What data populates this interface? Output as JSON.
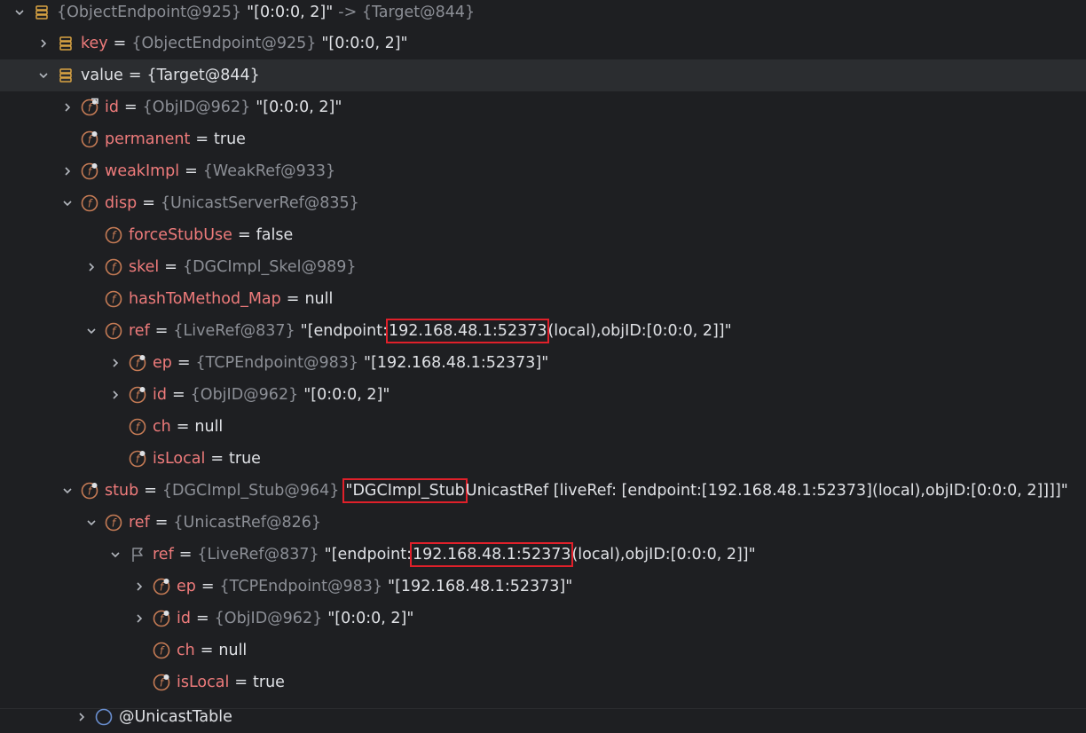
{
  "rows": [
    {
      "name": "",
      "type": "{ObjectEndpoint@925}",
      "value": "\"[0:0:0, 2]\"",
      "extra": "-> {Target@844}"
    },
    {
      "name": "key",
      "type": "{ObjectEndpoint@925}",
      "value": "\"[0:0:0, 2]\""
    },
    {
      "name": "value",
      "type": "{Target@844}",
      "value": ""
    },
    {
      "name": "id",
      "type": "{ObjID@962}",
      "value": "\"[0:0:0, 2]\""
    },
    {
      "name": "permanent",
      "type": "",
      "value": "true"
    },
    {
      "name": "weakImpl",
      "type": "{WeakRef@933}",
      "value": ""
    },
    {
      "name": "disp",
      "type": "{UnicastServerRef@835}",
      "value": ""
    },
    {
      "name": "forceStubUse",
      "type": "",
      "value": "false"
    },
    {
      "name": "skel",
      "type": "{DGCImpl_Skel@989}",
      "value": ""
    },
    {
      "name": "hashToMethod_Map",
      "type": "",
      "value": "null"
    },
    {
      "name": "ref",
      "type": "{LiveRef@837}",
      "pre": "\"[endpoint:",
      "hl": "192.168.48.1:52373",
      "post": "(local),objID:[0:0:0, 2]]\""
    },
    {
      "name": "ep",
      "type": "{TCPEndpoint@983}",
      "value": "\"[192.168.48.1:52373]\""
    },
    {
      "name": "id",
      "type": "{ObjID@962}",
      "value": "\"[0:0:0, 2]\""
    },
    {
      "name": "ch",
      "type": "",
      "value": "null"
    },
    {
      "name": "isLocal",
      "type": "",
      "value": "true"
    },
    {
      "name": "stub",
      "type": "{DGCImpl_Stub@964}",
      "hl": "\"DGCImpl_Stub",
      "post": "UnicastRef [liveRef: [endpoint:[192.168.48.1:52373](local),objID:[0:0:0, 2]]]]\""
    },
    {
      "name": "ref",
      "type": "{UnicastRef@826}",
      "value": ""
    },
    {
      "name": "ref",
      "type": "{LiveRef@837}",
      "pre": "\"[endpoint:",
      "hl": "192.168.48.1:52373",
      "post": "(local),objID:[0:0:0, 2]]\""
    },
    {
      "name": "ep",
      "type": "{TCPEndpoint@983}",
      "value": "\"[192.168.48.1:52373]\""
    },
    {
      "name": "id",
      "type": "{ObjID@962}",
      "value": "\"[0:0:0, 2]\""
    },
    {
      "name": "ch",
      "type": "",
      "value": "null"
    },
    {
      "name": "isLocal",
      "type": "",
      "value": "true"
    },
    {
      "name": "@UnicastTable",
      "type": "",
      "value": ""
    }
  ],
  "colors": {
    "background": "#1e1f22",
    "name": "#ee7b7b",
    "type": "#8c8f96",
    "highlight": "#e0202a",
    "field_icon": "#c57b55"
  }
}
